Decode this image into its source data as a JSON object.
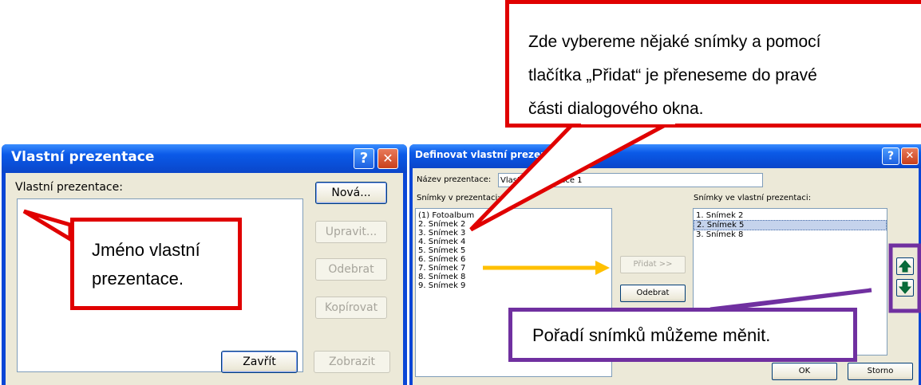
{
  "left_dialog": {
    "title": "Vlastní prezentace",
    "help_glyph": "?",
    "close_glyph": "✕",
    "list_label": "Vlastní prezentace:",
    "buttons": {
      "new": "Nová...",
      "edit": "Upravit...",
      "remove": "Odebrat",
      "copy": "Kopírovat",
      "close": "Zavřít",
      "show": "Zobrazit"
    }
  },
  "right_dialog": {
    "title": "Definovat vlastní prezen",
    "help_glyph": "?",
    "close_glyph": "✕",
    "name_label": "Název prezentace:",
    "name_value": "Vlastní prezentace 1",
    "slides_label": "Snímky v prezentaci:",
    "custom_label": "Snímky ve vlastní prezentaci:",
    "slides": [
      "(1) Fotoalbum",
      "2. Snímek 2",
      "3. Snímek 3",
      "4. Snímek 4",
      "5. Snímek 5",
      "6. Snímek 6",
      "7. Snímek 7",
      "8. Snímek 8",
      "9. Snímek 9"
    ],
    "custom_slides": [
      "1. Snímek 2",
      "2. Snímek 5",
      "3. Snímek 8"
    ],
    "selected_custom_index": 1,
    "add_button": "Přidat >>",
    "remove_button": "Odebrat",
    "ok_button": "OK",
    "cancel_button": "Storno",
    "up_icon": "arrow-up-icon",
    "down_icon": "arrow-down-icon"
  },
  "callouts": {
    "top": [
      "Zde vybereme nějaké snímky a pomocí",
      "tlačítka „Přidat“ je přeneseme do pravé",
      "části dialogového okna."
    ],
    "left": [
      "Jméno vlastní",
      "prezentace."
    ],
    "bottom": "Pořadí snímků můžeme měnit."
  },
  "colors": {
    "callout_red": "#e00000",
    "callout_purple": "#7030a0",
    "arrow_orange": "#ffc000",
    "xp_title_blue": "#0a4fd8",
    "dialog_face": "#ece9d8"
  }
}
